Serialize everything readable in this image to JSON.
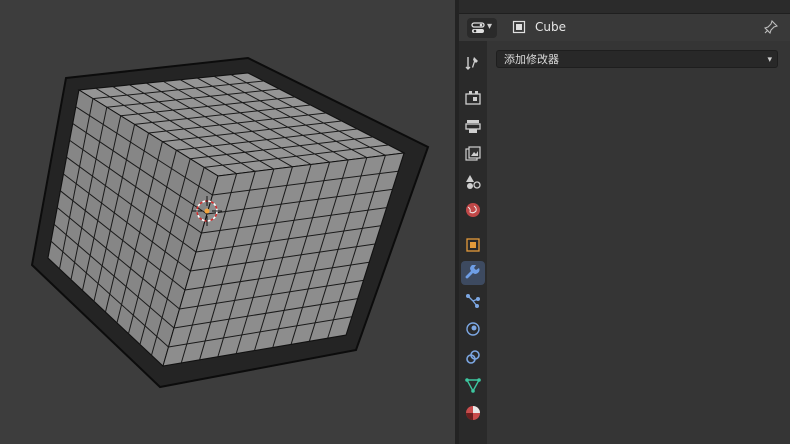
{
  "header": {
    "object_name": "Cube"
  },
  "modifiers": {
    "add_modifier_label": "添加修改器"
  },
  "icons": {
    "editor_type": "properties-editor-icon",
    "object": "object-data-icon",
    "pin": "pin-icon"
  },
  "tabs": [
    {
      "name": "tool",
      "active": false
    },
    {
      "name": "render",
      "active": false
    },
    {
      "name": "output",
      "active": false
    },
    {
      "name": "view-layer",
      "active": false
    },
    {
      "name": "scene",
      "active": false
    },
    {
      "name": "world",
      "active": false
    },
    {
      "name": "object",
      "active": false
    },
    {
      "name": "modifiers",
      "active": true
    },
    {
      "name": "particles",
      "active": false
    },
    {
      "name": "physics",
      "active": false
    },
    {
      "name": "constraints",
      "active": false
    },
    {
      "name": "data",
      "active": false
    },
    {
      "name": "material",
      "active": false
    }
  ],
  "colors": {
    "accent": "#5680c2",
    "panel_bg": "#303030",
    "viewport_bg": "#3d3d3d",
    "active_tab": "#3d4a60"
  }
}
